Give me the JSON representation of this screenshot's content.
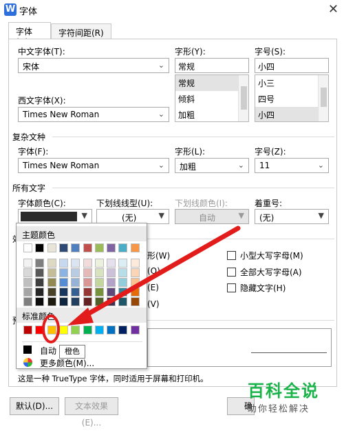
{
  "window": {
    "title": "字体",
    "app_icon_letter": "W",
    "close_glyph": "✕"
  },
  "tabs": [
    {
      "label": "字体(N)"
    },
    {
      "label": "字符间距(R)"
    }
  ],
  "chinese_font": {
    "label": "中文字体(T):",
    "value": "宋体"
  },
  "style": {
    "label": "字形(Y):",
    "value": "常规",
    "options": [
      "常规",
      "倾斜",
      "加粗"
    ],
    "selected_index": 0
  },
  "size": {
    "label": "字号(S):",
    "value": "小四",
    "options": [
      "小三",
      "四号",
      "小四"
    ],
    "selected_index": 2
  },
  "western_font": {
    "label": "西文字体(X):",
    "value": "Times New Roman"
  },
  "complex": {
    "section_title": "复杂文种",
    "font_label": "字体(F):",
    "font_value": "Times New Roman",
    "style_label": "字形(L):",
    "style_value": "加粗",
    "size_label": "字号(Z):",
    "size_value": "11"
  },
  "all_text": {
    "section_title": "所有文字",
    "font_color_label": "字体颜色(C):",
    "font_color_value": "#2b2b2b",
    "underline_type_label": "下划线线型(U):",
    "underline_type_value": "(无)",
    "underline_color_label": "下划线颜色(I):",
    "underline_color_value": "自动",
    "emphasis_label": "着重号:",
    "emphasis_value": "(无)"
  },
  "effects": {
    "section_title_fragment": "效",
    "left_fragments": [
      "形(W)",
      "(O)",
      "(E)",
      "(V)"
    ],
    "options": [
      {
        "label": "小型大写字母(M)",
        "checked": false
      },
      {
        "label": "全部大写字母(A)",
        "checked": false
      },
      {
        "label": "隐藏文字(H)",
        "checked": false
      }
    ]
  },
  "preview": {
    "section_title_fragment": "预"
  },
  "description": "这是一种 TrueType 字体，同时适用于屏幕和打印机。",
  "buttons": {
    "default": "默认(D)...",
    "text_effects": "文本效果(E)...",
    "ok_fragment": "确"
  },
  "color_popup": {
    "theme_header": "主题颜色",
    "standard_header": "标准颜色",
    "automatic_label": "自动",
    "more_colors_label": "更多颜色(M)...",
    "tooltip": "橙色",
    "theme_top_row": [
      "#ffffff",
      "#000000",
      "#e8e4d8",
      "#2e4a75",
      "#4f7fbf",
      "#c0504d",
      "#9bbb59",
      "#8064a2",
      "#4bacc6",
      "#f79646"
    ],
    "theme_shades": [
      [
        "#f2f2f2",
        "#7f7f7f",
        "#ddd9c3",
        "#c6d9f1",
        "#dbe5f1",
        "#f2dcdb",
        "#ebf1dd",
        "#e5e0ec",
        "#dbeef3",
        "#fdeada"
      ],
      [
        "#d9d9d9",
        "#595959",
        "#c4bd97",
        "#8db3e2",
        "#b8cce4",
        "#e5b9b7",
        "#d7e3bc",
        "#ccc1d9",
        "#b7dde8",
        "#fbd5b5"
      ],
      [
        "#bfbfbf",
        "#3f3f3f",
        "#938953",
        "#548dd4",
        "#95b3d7",
        "#d99694",
        "#c3d69b",
        "#b2a2c7",
        "#92cddc",
        "#fac08f"
      ],
      [
        "#a5a5a5",
        "#262626",
        "#494429",
        "#17365d",
        "#366092",
        "#953734",
        "#76923c",
        "#5f497a",
        "#31859b",
        "#e36c09"
      ],
      [
        "#7f7f7f",
        "#0c0c0c",
        "#1d1b10",
        "#0f243e",
        "#244061",
        "#632423",
        "#4f6128",
        "#3f3151",
        "#205867",
        "#974806"
      ]
    ],
    "standard_colors": [
      "#c00000",
      "#ff0000",
      "#ffc000",
      "#ffff00",
      "#92d050",
      "#00b050",
      "#00b0f0",
      "#0070c0",
      "#002060",
      "#7030a0"
    ]
  },
  "annotation": {
    "arrow_color": "#e21b1b"
  },
  "watermark": {
    "title": "百科全说",
    "subtitle": "助你轻松解决",
    "color": "#1ab34a"
  }
}
